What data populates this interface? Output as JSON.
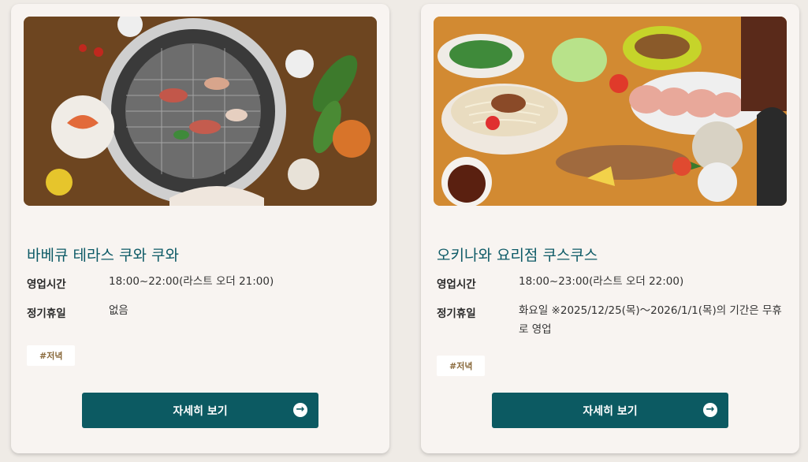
{
  "cards": [
    {
      "title": "바베큐 테라스 쿠와 쿠와",
      "hours_label": "영업시간",
      "hours_value": "18:00~22:00(라스트 오더 21:00)",
      "holiday_label": "정기휴일",
      "holiday_value": "없음",
      "tag": "#저녁",
      "button_label": "자세히 보기",
      "image_alt": "grilled yakiniku barbecue spread"
    },
    {
      "title": "오키나와 요리점 쿠스쿠스",
      "hours_label": "영업시간",
      "hours_value": "18:00~23:00(라스트 오더 22:00)",
      "holiday_label": "정기휴일",
      "holiday_value": "화요일 ※2025/12/25(목)～2026/1/1(목)의 기간은 무휴로 영업",
      "tag": "#저녁",
      "button_label": "자세히 보기",
      "image_alt": "Okinawan cuisine spread with soba and sashimi"
    }
  ],
  "icons": {
    "button_arrow": "arrow-right-circle-icon"
  },
  "colors": {
    "accent": "#0c5a62",
    "title": "#0d5a66",
    "tag_text": "#8a6a3c",
    "card_bg": "#f8f4f1",
    "page_bg": "#efebe6"
  }
}
